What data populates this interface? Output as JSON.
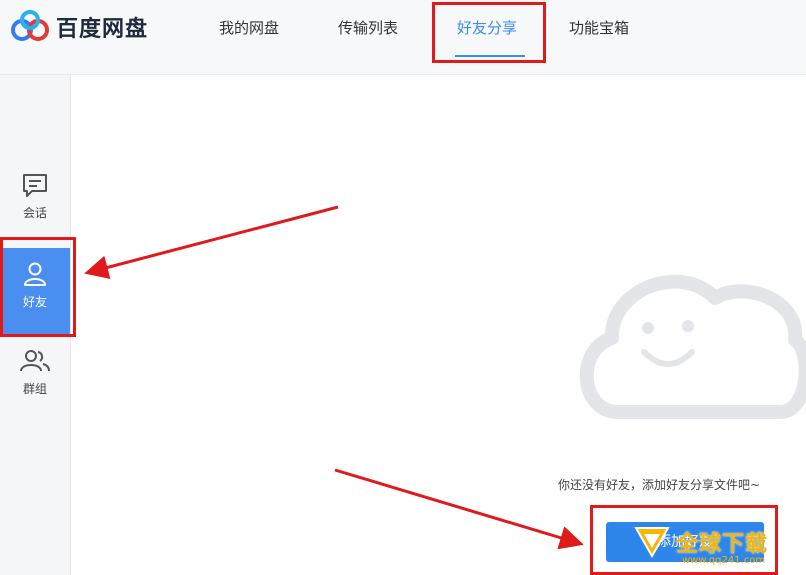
{
  "app": {
    "name": "百度网盘"
  },
  "nav": {
    "items": [
      {
        "label": "我的网盘"
      },
      {
        "label": "传输列表"
      },
      {
        "label": "好友分享",
        "active": true
      },
      {
        "label": "功能宝箱"
      }
    ]
  },
  "sidebar": {
    "items": [
      {
        "label": "会话",
        "icon": "chat-icon"
      },
      {
        "label": "好友",
        "icon": "user-icon",
        "active": true
      },
      {
        "label": "群组",
        "icon": "group-icon"
      }
    ]
  },
  "main": {
    "empty_message": "你还没有好友，添加好友分享文件吧~",
    "add_button_label": "添加好友",
    "empty_icon": "smiling-cloud-icon"
  },
  "watermark": {
    "text": "全球下载",
    "url": "www.qq241.com"
  },
  "colors": {
    "accent": "#3b8cf0",
    "sidebar_active": "#4a8ef0",
    "annotation": "#e0191b",
    "watermark": "#f7b500"
  }
}
